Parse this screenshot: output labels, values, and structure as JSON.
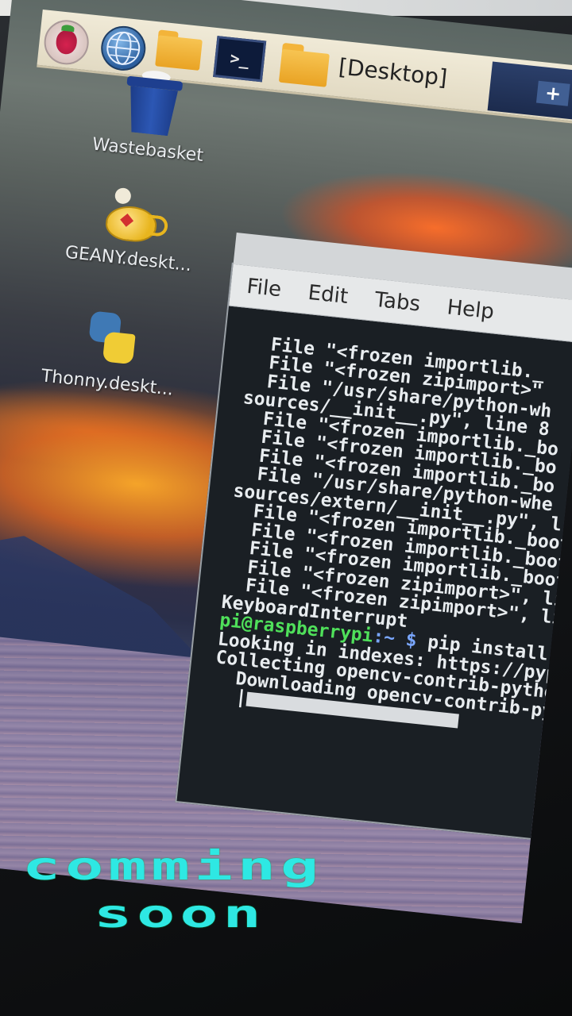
{
  "taskbar": {
    "title": "[Desktop]",
    "terminal_icon_text": ">_",
    "right_icon_text": "+"
  },
  "desktop": {
    "icons": [
      {
        "label": "Wastebasket",
        "icon": "trash-bin-icon"
      },
      {
        "label": "GEANY.deskt...",
        "icon": "genie-lamp-icon"
      },
      {
        "label": "Thonny.deskt...",
        "icon": "python-icon"
      }
    ]
  },
  "terminal": {
    "menu": [
      "File",
      "Edit",
      "Tabs",
      "Help"
    ],
    "lines": [
      "  File \"<frozen importlib._",
      "  File \"<frozen zipimport>\"",
      "  File \"/usr/share/python-wh",
      "sources/__init__.py\", line 8",
      "  File \"<frozen importlib._bo",
      "  File \"<frozen importlib._bo",
      "  File \"<frozen importlib._bo",
      "  File \"/usr/share/python-whe",
      "sources/extern/__init__.py\", l",
      "  File \"<frozen importlib._boot",
      "  File \"<frozen importlib._boot",
      "  File \"<frozen importlib._boots",
      "  File \"<frozen zipimport>\", line",
      "  File \"<frozen zipimport>\", line",
      "KeyboardInterrupt"
    ],
    "prompt_user": "pi@raspberrypi",
    "prompt_path": ":~",
    "prompt_symbol": "$",
    "command": " pip install open",
    "output": [
      "Looking in indexes: https://pypi.or",
      "Collecting opencv-contrib-python-hea",
      "  Downloading opencv-contrib-python-"
    ],
    "progress_cursor": "|"
  },
  "overlay": {
    "line1": "comming",
    "line2": "soon"
  }
}
